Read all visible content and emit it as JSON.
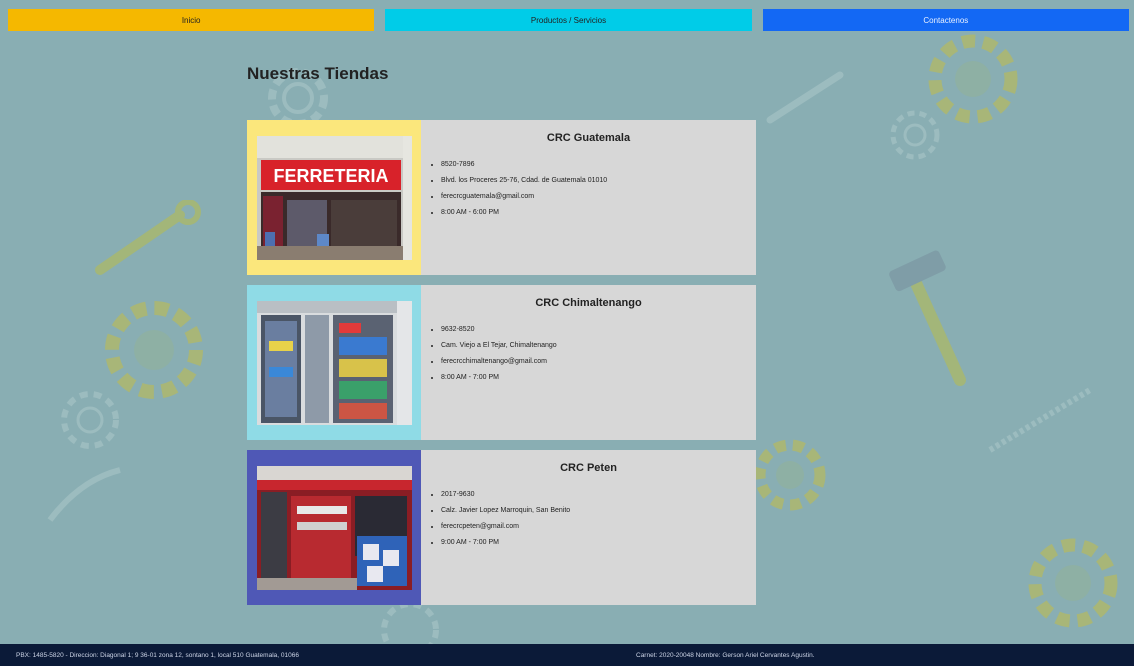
{
  "nav": {
    "inicio": "Inicio",
    "productos": "Productos / Servicios",
    "contactenos": "Contactenos"
  },
  "page_title": "Nuestras Tiendas",
  "stores": [
    {
      "name": "CRC Guatemala",
      "phone": "8520-7896",
      "address": "Blvd. los Proceres 25-76, Cdad. de Guatemala 01010",
      "email": "ferecrcguatemala@gmail.com",
      "hours": "8:00 AM - 6:00 PM",
      "sign_text": "FERRETERIA",
      "accent": "#fbe77c"
    },
    {
      "name": "CRC Chimaltenango",
      "phone": "9632-8520",
      "address": "Cam. Viejo a El Tejar, Chimaltenango",
      "email": "ferecrcchimaltenango@gmail.com",
      "hours": "8:00 AM - 7:00 PM",
      "accent": "#8fdbe6"
    },
    {
      "name": "CRC Peten",
      "phone": "2017-9630",
      "address": "Calz. Javier Lopez Marroquin, San Benito",
      "email": "ferecrcpeten@gmail.com",
      "hours": "9:00 AM - 7:00 PM",
      "accent": "#4f58b6"
    }
  ],
  "footer": {
    "left": "PBX: 1485-5820   -   Direccion: Diagonal 1; 9 36-01 zona 12, sontano 1, local 510 Guatemala, 01066",
    "right": "Carnet: 2020-20048    Nombre: Gerson Ariel Cervantes Agustin."
  }
}
